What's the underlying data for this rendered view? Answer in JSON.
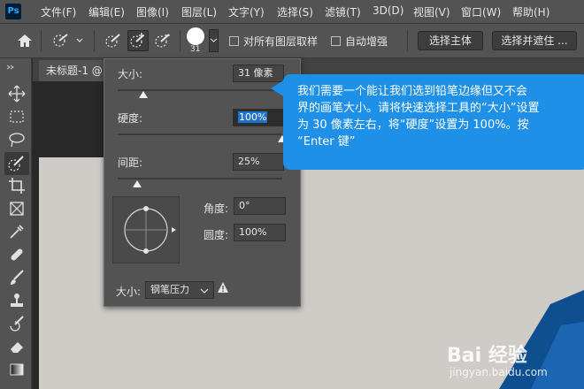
{
  "app": {
    "logo": "Ps"
  },
  "menu": [
    {
      "label": "文件(F)"
    },
    {
      "label": "编辑(E)"
    },
    {
      "label": "图像(I)"
    },
    {
      "label": "图层(L)"
    },
    {
      "label": "文字(Y)"
    },
    {
      "label": "选择(S)"
    },
    {
      "label": "滤镜(T)"
    },
    {
      "label": "3D(D)"
    },
    {
      "label": "视图(V)"
    },
    {
      "label": "窗口(W)"
    },
    {
      "label": "帮助(H)"
    }
  ],
  "options": {
    "brush_size": "31",
    "sample_all_layers": "对所有图层取样",
    "auto_enhance": "自动增强",
    "select_subject": "选择主体",
    "select_and_mask": "选择并遮住 ..."
  },
  "document": {
    "tab": "未标题-1 @"
  },
  "brush_popup": {
    "size_label": "大小:",
    "size_value": "31 像素",
    "hardness_label": "硬度:",
    "hardness_value": "100%",
    "spacing_label": "间距:",
    "spacing_value": "25%",
    "angle_label": "角度:",
    "angle_value": "0°",
    "roundness_label": "圆度:",
    "roundness_value": "100%",
    "pen_label": "大小:",
    "pen_value": "钢笔压力",
    "warning_icon": "warning-icon"
  },
  "tooltip": {
    "text": "我们需要一个能让我们选到铅笔边缘但又不会\n界的画笔大小。请将快速选择工具的“大小”设置\n为 30 像素左右，将“硬度”设置为 100%。按\n“Enter 键”"
  },
  "watermark": {
    "brand": "Bai 经验",
    "url": "jingyan.baidu.com"
  },
  "colors": {
    "accent": "#1e90e8",
    "panel": "#535353",
    "canvas": "#cfccc8",
    "shape": "#0f4f8f"
  }
}
